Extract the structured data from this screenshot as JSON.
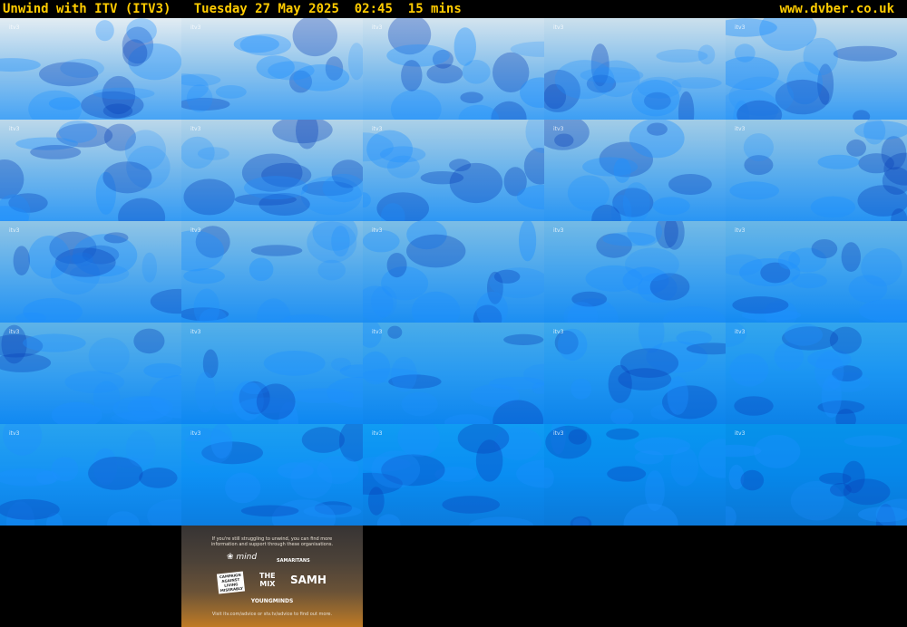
{
  "header": {
    "channel": "Unwind with ITV (ITV3)",
    "date": "Tuesday 27 May 2025",
    "time": "02:45",
    "duration": "15 mins",
    "site": "www.dvber.co.uk"
  },
  "thumbnails": {
    "watermark": "itv3",
    "count": 26
  },
  "advice_card": {
    "intro_line1": "If you're still struggling to unwind, you can find more",
    "intro_line2": "information and support through these organisations.",
    "org_mind": "mind",
    "org_samaritans": "SAMARITANS",
    "org_calm_line1": "CAMPAIGN",
    "org_calm_line2": "AGAINST",
    "org_calm_line3": "LIVING",
    "org_calm_line4": "MISERABLY",
    "org_the": "THE",
    "org_mix": "MIX",
    "org_samh": "SAMH",
    "org_youngminds": "YOUNGMINDS",
    "footer": "Visit itv.com/advice or stv.tv/advice to find out more."
  },
  "colors": {
    "header_text": "#ffcc00",
    "background": "#000000"
  }
}
